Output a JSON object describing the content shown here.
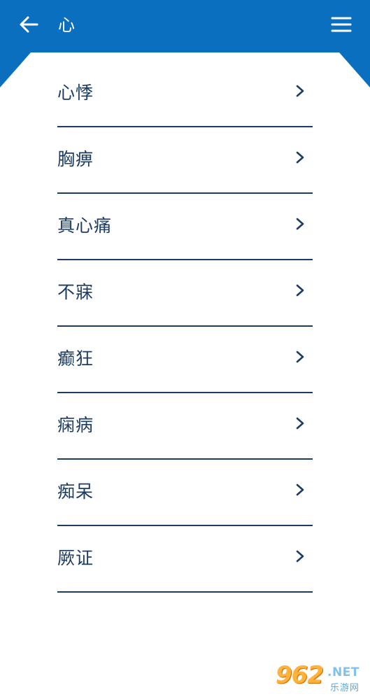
{
  "header": {
    "title": "心",
    "back_icon": "arrow-left-icon",
    "menu_icon": "hamburger-menu-icon",
    "background_color": "#0a6fbe",
    "text_color": "#ffffff"
  },
  "list": {
    "text_color": "#1d3c64",
    "chevron_icon": "chevron-right-icon",
    "items": [
      {
        "label": "心悸"
      },
      {
        "label": "胸痹"
      },
      {
        "label": "真心痛"
      },
      {
        "label": "不寐"
      },
      {
        "label": "癫狂"
      },
      {
        "label": "痫病"
      },
      {
        "label": "痴呆"
      },
      {
        "label": "厥证"
      }
    ]
  },
  "watermark": {
    "logo_text": "962",
    "domain_text": ".NET",
    "site_name": "乐游网"
  }
}
